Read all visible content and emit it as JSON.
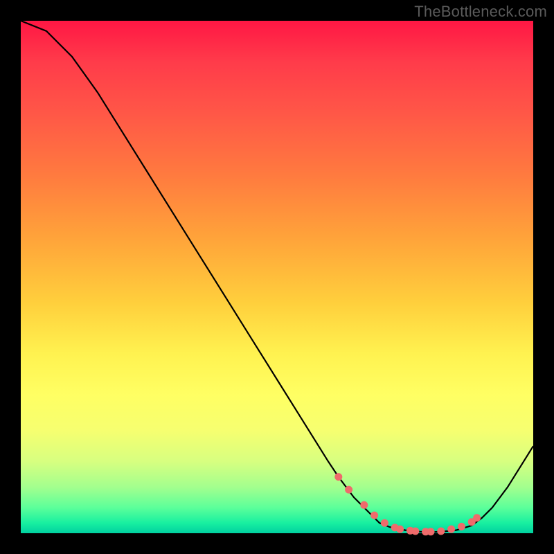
{
  "watermark": "TheBottleneck.com",
  "chart_data": {
    "type": "line",
    "title": "",
    "xlabel": "",
    "ylabel": "",
    "xlim": [
      0,
      100
    ],
    "ylim": [
      0,
      100
    ],
    "series": [
      {
        "name": "bottleneck-curve",
        "x": [
          0,
          5,
          10,
          15,
          20,
          25,
          30,
          35,
          40,
          45,
          50,
          55,
          60,
          62,
          65,
          68,
          70,
          72,
          75,
          78,
          80,
          82,
          85,
          88,
          90,
          92,
          95,
          100
        ],
        "y": [
          100,
          98,
          93,
          86,
          78,
          70,
          62,
          54,
          46,
          38,
          30,
          22,
          14,
          11,
          7,
          4,
          2,
          1.2,
          0.6,
          0.3,
          0.2,
          0.3,
          0.6,
          1.5,
          3,
          5,
          9,
          17
        ]
      }
    ],
    "markers": {
      "name": "highlight-dots",
      "x": [
        62,
        64,
        67,
        69,
        71,
        73,
        74,
        76,
        77,
        79,
        80,
        82,
        84,
        86,
        88,
        89
      ],
      "y": [
        11,
        8.5,
        5.5,
        3.5,
        2,
        1.1,
        0.8,
        0.5,
        0.4,
        0.3,
        0.3,
        0.4,
        0.8,
        1.3,
        2.2,
        3
      ]
    },
    "colors": {
      "line": "#000000",
      "marker": "#ef6b6b",
      "gradient_top": "#ff1744",
      "gradient_mid": "#fff250",
      "gradient_bottom": "#00d0a0"
    }
  }
}
